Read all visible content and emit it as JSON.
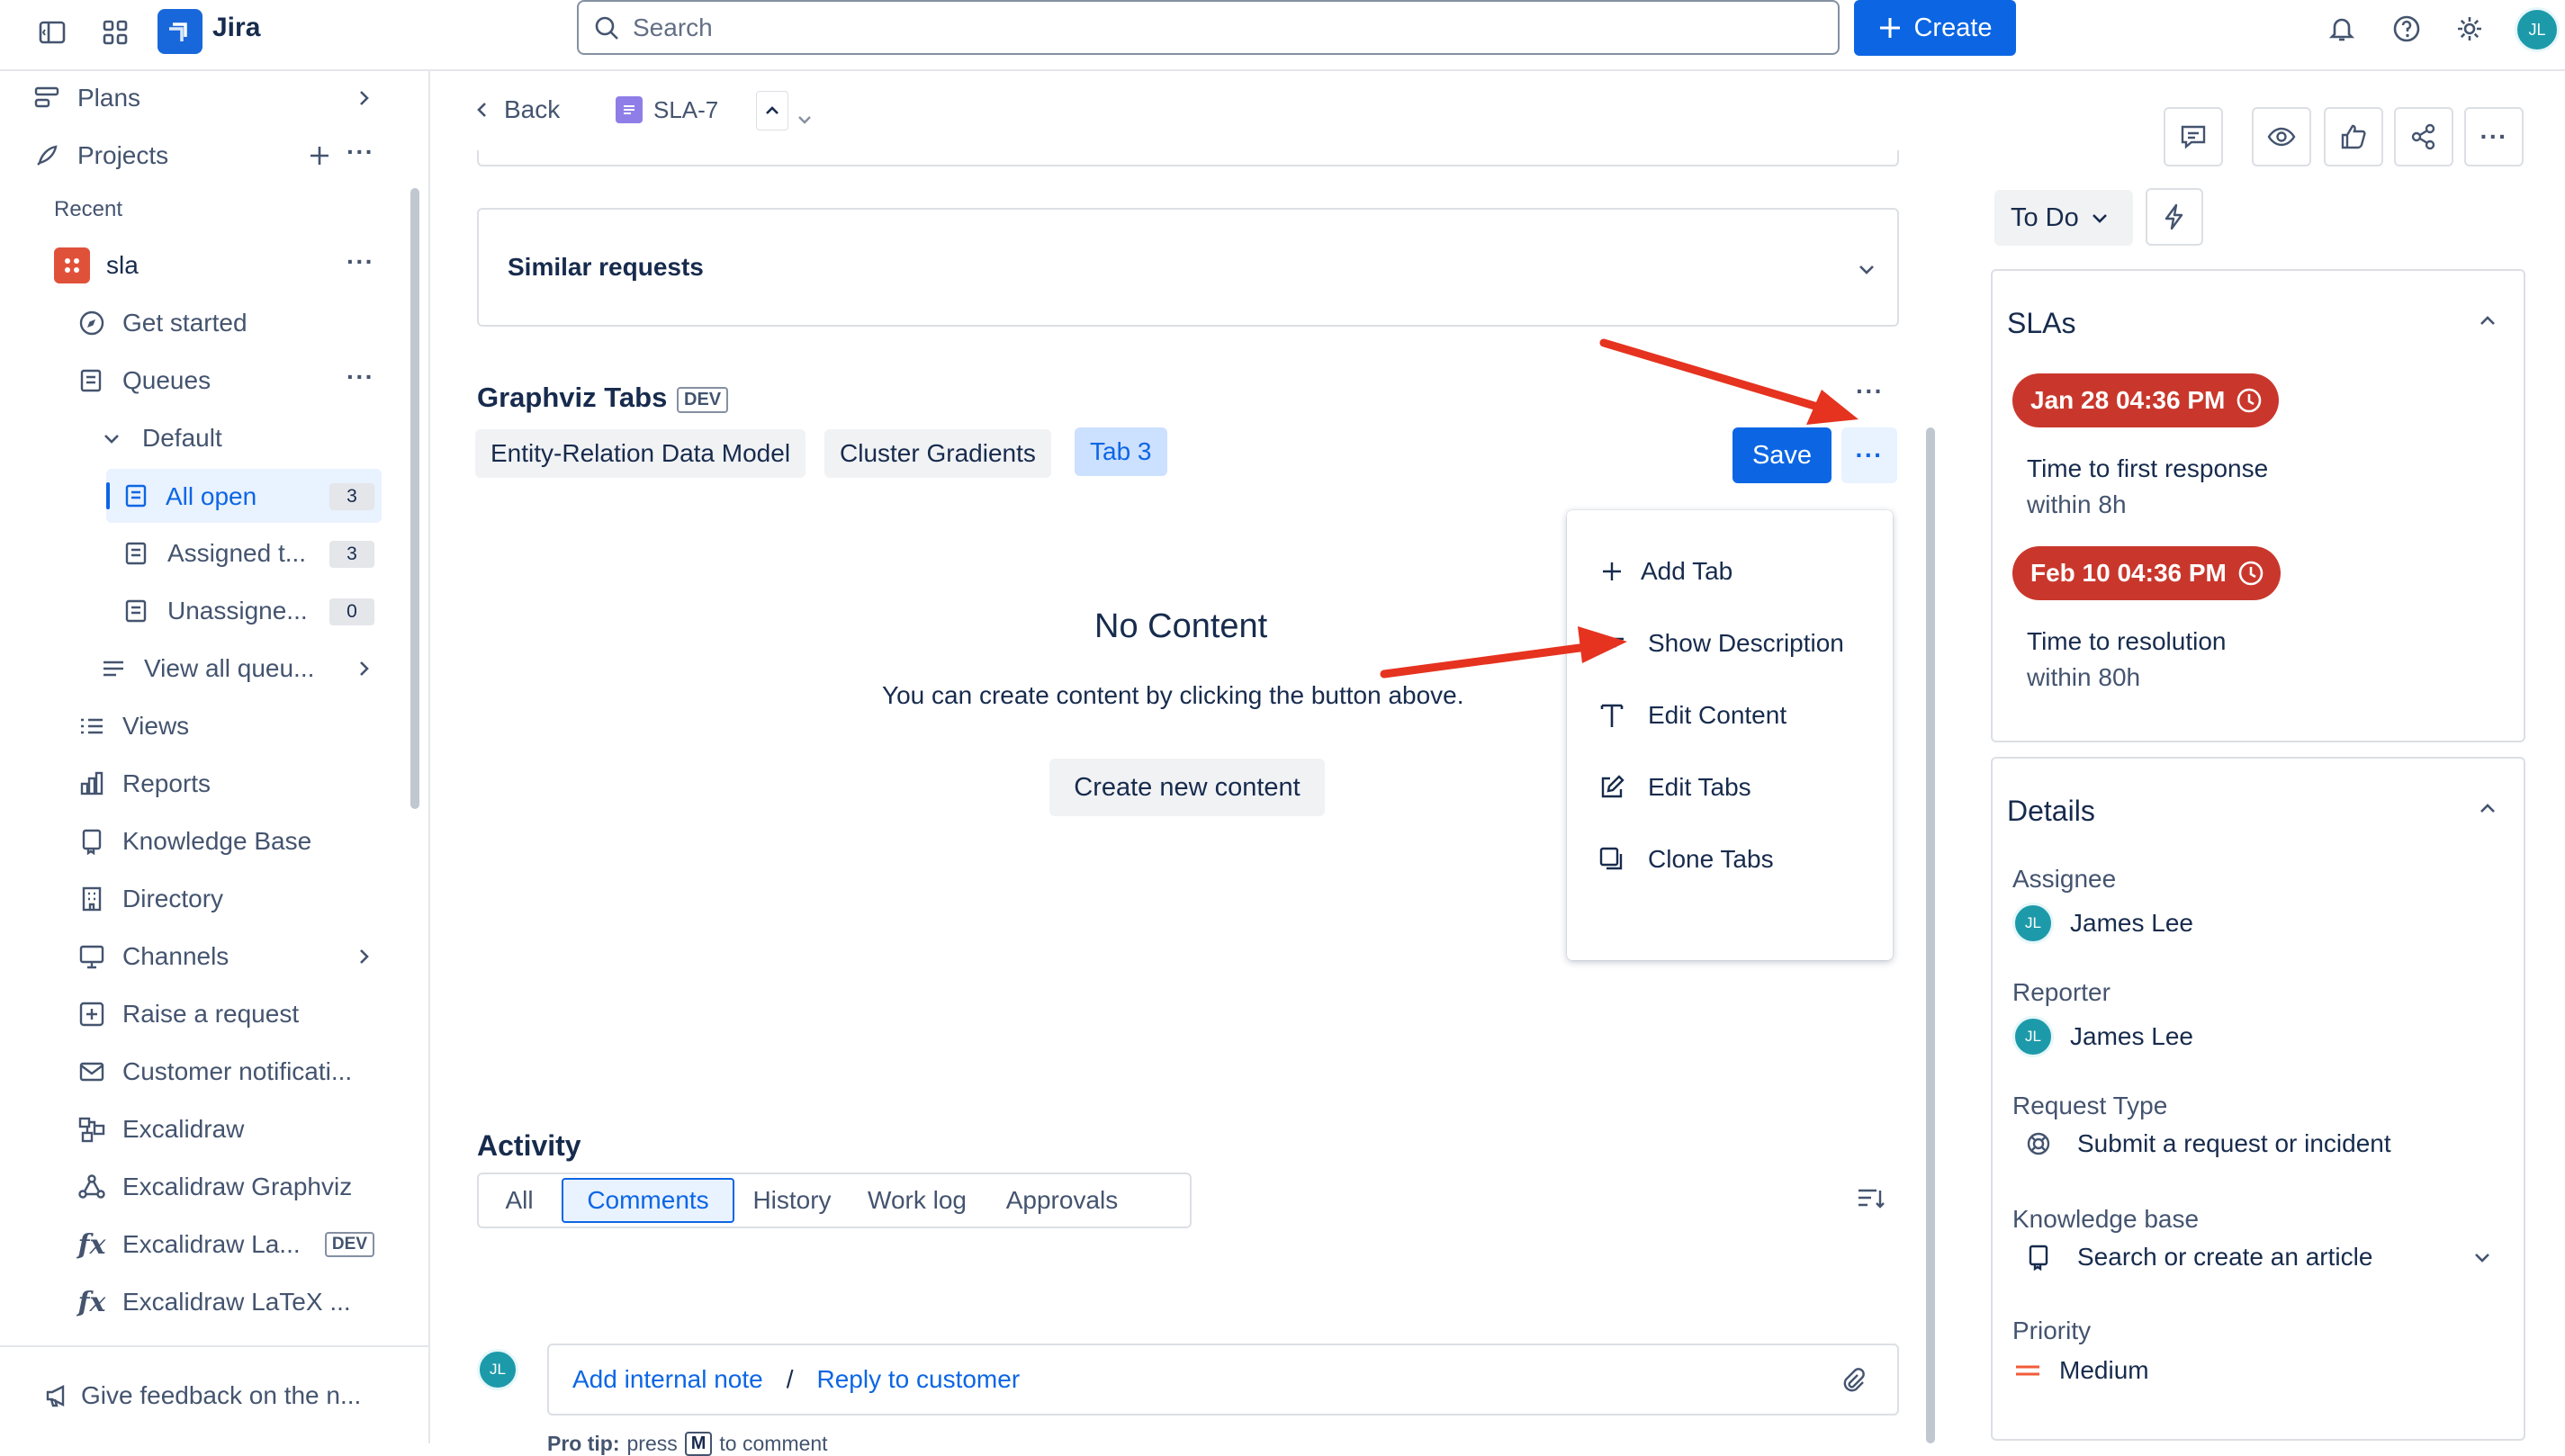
{
  "topbar": {
    "app_name": "Jira",
    "search_placeholder": "Search",
    "create_label": "Create",
    "avatar_initials": "JL"
  },
  "sidebar": {
    "plans": "Plans",
    "projects": "Projects",
    "recent": "Recent",
    "project_name": "sla",
    "get_started": "Get started",
    "queues": "Queues",
    "default": "Default",
    "all_open": "All open",
    "all_open_count": "3",
    "assigned": "Assigned t...",
    "assigned_count": "3",
    "unassigned": "Unassigne...",
    "unassigned_count": "0",
    "view_all_queues": "View all queu...",
    "views": "Views",
    "reports": "Reports",
    "knowledge_base": "Knowledge Base",
    "directory": "Directory",
    "channels": "Channels",
    "raise_request": "Raise a request",
    "customer_notifications": "Customer notificati...",
    "excalidraw": "Excalidraw",
    "excalidraw_graphviz": "Excalidraw Graphviz",
    "excalidraw_la": "Excalidraw La...",
    "dev_badge": "DEV",
    "excalidraw_latex": "Excalidraw LaTeX ...",
    "feedback": "Give feedback on the n..."
  },
  "main": {
    "back": "Back",
    "issue_key": "SLA-7",
    "similar_requests": "Similar requests",
    "graphviz_title": "Graphviz Tabs",
    "dev_badge": "DEV",
    "tabs": [
      "Entity-Relation Data Model",
      "Cluster Gradients",
      "Tab 3"
    ],
    "save": "Save",
    "no_content_title": "No Content",
    "no_content_text": "You can create content by clicking the button above.",
    "create_new_content": "Create new content",
    "menu": [
      "Add Tab",
      "Show Description",
      "Edit Content",
      "Edit Tabs",
      "Clone Tabs"
    ],
    "activity_title": "Activity",
    "activity_tabs": [
      "All",
      "Comments",
      "History",
      "Work log",
      "Approvals"
    ],
    "avatar_initials": "JL",
    "add_internal_note": "Add internal note",
    "separator": "/",
    "reply_to_customer": "Reply to customer",
    "pro_tip_label": "Pro tip:",
    "pro_tip_press": "press",
    "pro_tip_key": "M",
    "pro_tip_rest": "to comment"
  },
  "right": {
    "status": "To Do",
    "slas_title": "SLAs",
    "sla1_time": "Jan 28 04:36 PM",
    "sla1_label": "Time to first response",
    "sla1_goal": "within 8h",
    "sla2_time": "Feb 10 04:36 PM",
    "sla2_label": "Time to resolution",
    "sla2_goal": "within 80h",
    "details_title": "Details",
    "assignee_label": "Assignee",
    "assignee": "James Lee",
    "reporter_label": "Reporter",
    "reporter": "James Lee",
    "avatar_initials": "JL",
    "request_type_label": "Request Type",
    "request_type": "Submit a request or incident",
    "kb_label": "Knowledge base",
    "kb_value": "Search or create an article",
    "priority_label": "Priority",
    "priority": "Medium"
  },
  "colors": {
    "primary": "#0c66e4",
    "selected_bg": "#e9f2ff",
    "sla_red": "#c9372c",
    "annotation_arrow": "#e5331f",
    "priority_orange": "#f15b3a"
  }
}
